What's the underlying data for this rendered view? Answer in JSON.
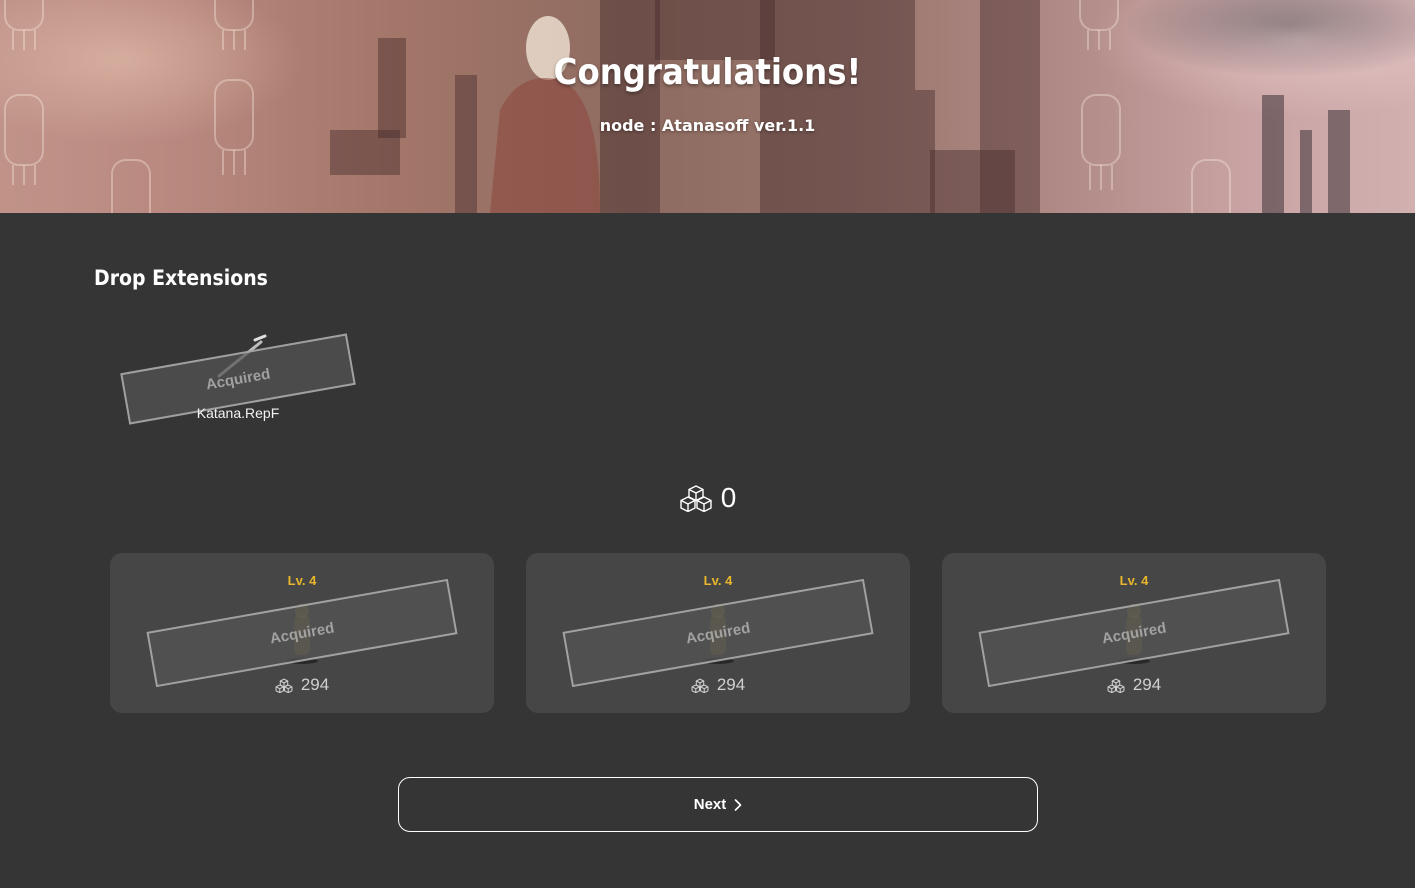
{
  "banner": {
    "title": "Congratulations!",
    "subtitle": "node : Atanasoff ver.1.1"
  },
  "drop_extensions": {
    "title": "Drop Extensions",
    "items": [
      {
        "name": "Katana.RepF",
        "status": "Acquired",
        "icon": "katana-sprite-icon"
      }
    ]
  },
  "counter": {
    "icon": "cubes-icon",
    "value": "0"
  },
  "cards": [
    {
      "level": "Lv. 4",
      "status": "Acquired",
      "cost": "294",
      "cost_icon": "cubes-icon"
    },
    {
      "level": "Lv. 4",
      "status": "Acquired",
      "cost": "294",
      "cost_icon": "cubes-icon"
    },
    {
      "level": "Lv. 4",
      "status": "Acquired",
      "cost": "294",
      "cost_icon": "cubes-icon"
    }
  ],
  "next_button": {
    "label": "Next",
    "icon": "chevron-right-icon"
  },
  "colors": {
    "background": "#353535",
    "card_background": "#464646",
    "level_accent": "#e8b62c"
  }
}
